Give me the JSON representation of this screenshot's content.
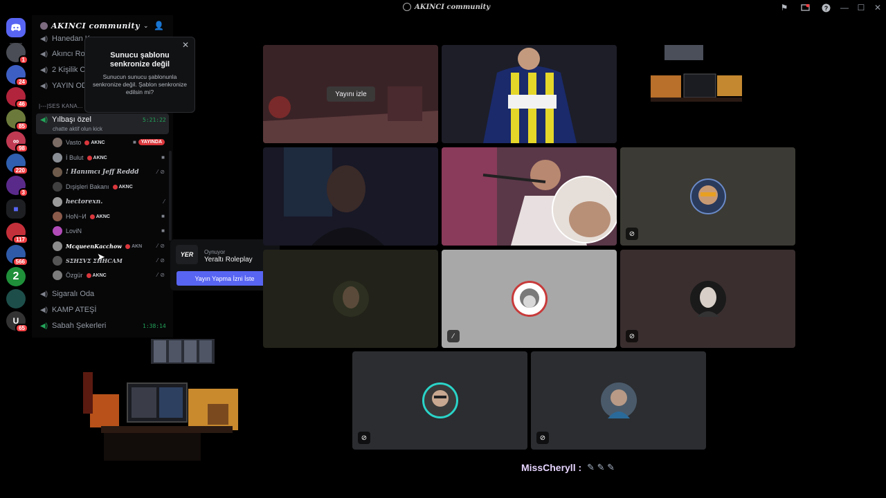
{
  "window": {
    "title": "AKINCI community",
    "icons": [
      "flag-icon",
      "screen-icon",
      "help-icon",
      "minimize-icon",
      "maximize-icon",
      "close-icon"
    ]
  },
  "servers": [
    {
      "name": "home",
      "badge": ""
    },
    {
      "name": "s1",
      "badge": "1"
    },
    {
      "name": "s2",
      "badge": "24"
    },
    {
      "name": "s3",
      "badge": "46"
    },
    {
      "name": "s4",
      "badge": "85"
    },
    {
      "name": "s5",
      "badge": "98"
    },
    {
      "name": "s6",
      "badge": "220"
    },
    {
      "name": "s7",
      "badge": "3"
    },
    {
      "name": "folder",
      "badge": ""
    },
    {
      "name": "s8",
      "badge": "117"
    },
    {
      "name": "s9",
      "badge": "566"
    },
    {
      "name": "s10",
      "badge": ""
    },
    {
      "name": "s11",
      "badge": ""
    },
    {
      "name": "s12",
      "badge": "65"
    }
  ],
  "guild": {
    "name": "AKINCI community",
    "category": "|---|SES KANA...",
    "channels_top": [
      "Hanedan K...",
      "Akıncı Ro...",
      "2 Kişilik O...",
      "YAYIN OD..."
    ],
    "active_channel": {
      "name": "Yılbaşı özel",
      "sub": "chatte aktif olun kick",
      "timer": "5:21:22"
    },
    "voice_users": [
      {
        "name": "Vasto",
        "tag": "AKNC",
        "extra": "YAYINDA"
      },
      {
        "name": "İ Bulut",
        "tag": "AKNC",
        "extra": ""
      },
      {
        "name": "! Hanımcı Jeff Reddd",
        "tag": "",
        "extra": ""
      },
      {
        "name": "Dışişleri Bakanı",
        "tag": "AKNC",
        "extra": ""
      },
      {
        "name": "hectorexn.",
        "tag": "",
        "extra": ""
      },
      {
        "name": "HoN~И",
        "tag": "AKNC",
        "extra": ""
      },
      {
        "name": "LoviN",
        "tag": "",
        "extra": ""
      },
      {
        "name": "McqueenKacchow",
        "tag": "AKN",
        "extra": ""
      },
      {
        "name": "ЅΣΗΣVΣ ΣΗΗСАМ",
        "tag": "",
        "extra": ""
      },
      {
        "name": "Özgür",
        "tag": "AKNC",
        "extra": ""
      }
    ],
    "channels_bottom": [
      {
        "name": "Sigaralı Oda",
        "timer": ""
      },
      {
        "name": "KAMP ATEŞİ",
        "timer": ""
      },
      {
        "name": "Sabah Şekerleri",
        "timer": "1:38:14"
      }
    ]
  },
  "tooltip": {
    "title": "Sunucu şablonu senkronize değil",
    "body": "Sunucun sunucu şablonunla senkronize değil. Şablon senkronize edilsin mi?"
  },
  "popout": {
    "label": "Oynuyor",
    "game": "Yeraltı Roleplay",
    "logo_text": "YER",
    "button": "Yayın Yapma İzni İste"
  },
  "stage": {
    "watch_button": "Yayını izle",
    "caption_name": "MissCheryll :",
    "caption_emoji": "✎ ✎ ✎"
  },
  "colors": {
    "blurple": "#5865f2",
    "live_red": "#da373c",
    "online_green": "#23a55a",
    "caption": "#e6d4ff"
  }
}
